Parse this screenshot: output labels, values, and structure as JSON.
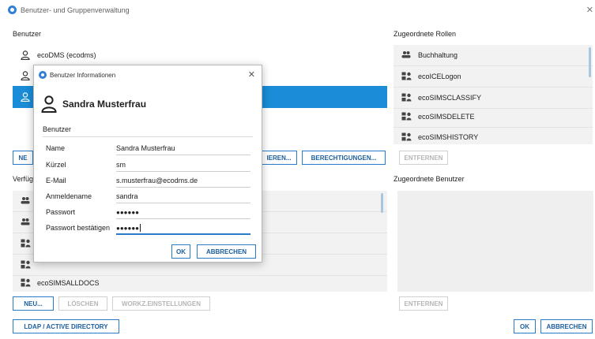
{
  "window": {
    "title": "Benutzer- und Gruppenverwaltung"
  },
  "users": {
    "label": "Benutzer",
    "items": [
      {
        "name": "ecoDMS (ecodms)",
        "selected": false
      },
      {
        "name": "",
        "selected": false
      },
      {
        "name": "",
        "selected": true
      }
    ],
    "buttons": {
      "new": "NE",
      "edit_partial": "IEREN...",
      "permissions": "BERECHTIGUNGEN..."
    }
  },
  "available": {
    "label": "Verfüg",
    "items": [
      {
        "icon": "group-icon",
        "name": ""
      },
      {
        "icon": "group-icon",
        "name": ""
      },
      {
        "icon": "role-icon",
        "name": ""
      },
      {
        "icon": "role-icon",
        "name": ""
      },
      {
        "icon": "role-icon",
        "name": "ecoSIMSALLDOCS"
      }
    ],
    "buttons": {
      "new": "NEU...",
      "delete": "LÖSCHEN",
      "workz": "WORKZ.EINSTELLUNGEN"
    }
  },
  "assigned_roles": {
    "label": "Zugeordnete Rollen",
    "items": [
      {
        "icon": "group-icon",
        "name": "Buchhaltung"
      },
      {
        "icon": "role-icon",
        "name": "ecoICELogon"
      },
      {
        "icon": "role-icon",
        "name": "ecoSIMSCLASSIFY"
      },
      {
        "icon": "role-icon",
        "name": "ecoSIMSDELETE"
      },
      {
        "icon": "role-icon",
        "name": "ecoSIMSHISTORY"
      }
    ],
    "remove": "ENTFERNEN"
  },
  "assigned_users": {
    "label": "Zugeordnete Benutzer",
    "remove": "ENTFERNEN"
  },
  "footer": {
    "ldap": "LDAP / ACTIVE DIRECTORY",
    "ok": "OK",
    "cancel": "ABBRECHEN"
  },
  "dialog": {
    "title": "Benutzer Informationen",
    "user_display": "Sandra Musterfrau",
    "section": "Benutzer",
    "fields": [
      {
        "label": "Name",
        "value": "Sandra Musterfrau"
      },
      {
        "label": "Kürzel",
        "value": "sm"
      },
      {
        "label": "E-Mail",
        "value": "s.musterfrau@ecodms.de"
      },
      {
        "label": "Anmeldename",
        "value": "sandra"
      },
      {
        "label": "Passwort",
        "value": "●●●●●●"
      },
      {
        "label": "Passwort bestätigen",
        "value": "●●●●●●"
      }
    ],
    "ok": "OK",
    "cancel": "ABBRECHEN"
  },
  "colors": {
    "accent": "#1a8cd8",
    "button_border": "#2a7bc5",
    "panel_bg": "#f2f2f2"
  }
}
